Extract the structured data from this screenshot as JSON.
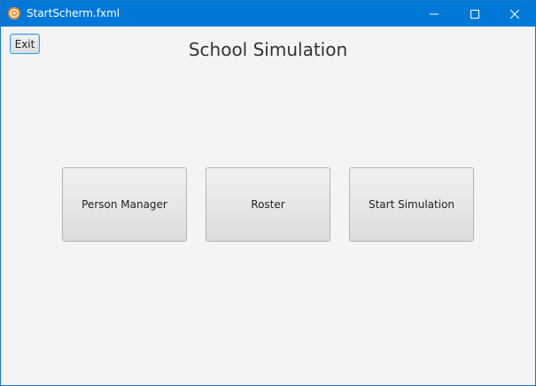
{
  "window": {
    "title": "StartScherm.fxml",
    "app_icon": "java-fx-icon",
    "controls": {
      "minimize": "minimize-icon",
      "maximize": "maximize-icon",
      "close": "close-icon"
    },
    "titlebar_color": "#0078d7"
  },
  "toolbar": {
    "exit_label": "Exit"
  },
  "main": {
    "heading": "School Simulation",
    "buttons": [
      {
        "label": "Person Manager"
      },
      {
        "label": "Roster"
      },
      {
        "label": "Start Simulation"
      }
    ]
  }
}
